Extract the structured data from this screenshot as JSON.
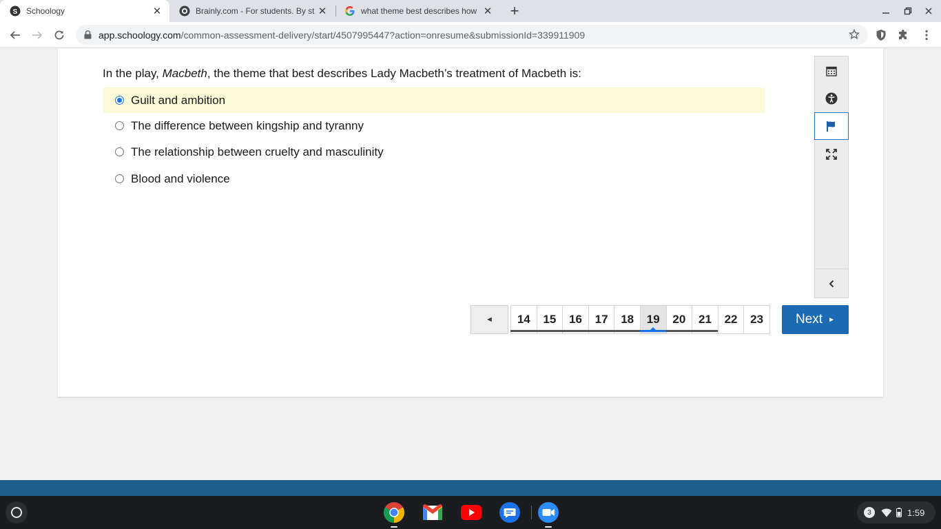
{
  "browser": {
    "tabs": [
      {
        "title": "Schoology",
        "favicon": "schoology-icon",
        "active": true
      },
      {
        "title": "Brainly.com - For students. By st",
        "favicon": "brainly-icon",
        "active": false
      },
      {
        "title": "what theme best describes how",
        "favicon": "google-icon",
        "active": false
      }
    ],
    "url_host": "app.schoology.com",
    "url_path": "/common-assessment-delivery/start/4507995447?action=onresume&submissionId=339911909"
  },
  "question": {
    "prefix": "In the play, ",
    "title_italic": "Macbeth",
    "suffix": ", the theme that best describes Lady Macbeth’s treatment of Macbeth is:"
  },
  "choices": [
    {
      "label": "Guilt and ambition",
      "selected": true
    },
    {
      "label": "The difference between kingship and tyranny",
      "selected": false
    },
    {
      "label": "The relationship between cruelty and masculinity",
      "selected": false
    },
    {
      "label": "Blood and violence",
      "selected": false
    }
  ],
  "tools": [
    "calendar-icon",
    "accessibility-icon",
    "flag-icon",
    "fullscreen-icon"
  ],
  "pager": {
    "prev_glyph": "◄",
    "pages": [
      "14",
      "15",
      "16",
      "17",
      "18",
      "19",
      "20",
      "21",
      "22",
      "23"
    ],
    "current": "19",
    "answered": [
      "14",
      "15",
      "16",
      "17",
      "18",
      "19",
      "20",
      "21"
    ],
    "next_label": "Next",
    "next_glyph": "►"
  },
  "shelf": {
    "apps": [
      "chrome-icon",
      "gmail-icon",
      "youtube-icon",
      "messages-icon",
      "zoom-icon"
    ],
    "notification_count": "3",
    "time": "1:59"
  },
  "colors": {
    "selected_choice_bg": "#fbfad7",
    "next_button": "#1b6bb3",
    "footer_bar": "#1f5f8b",
    "radio_checked": "#1a73e8"
  }
}
